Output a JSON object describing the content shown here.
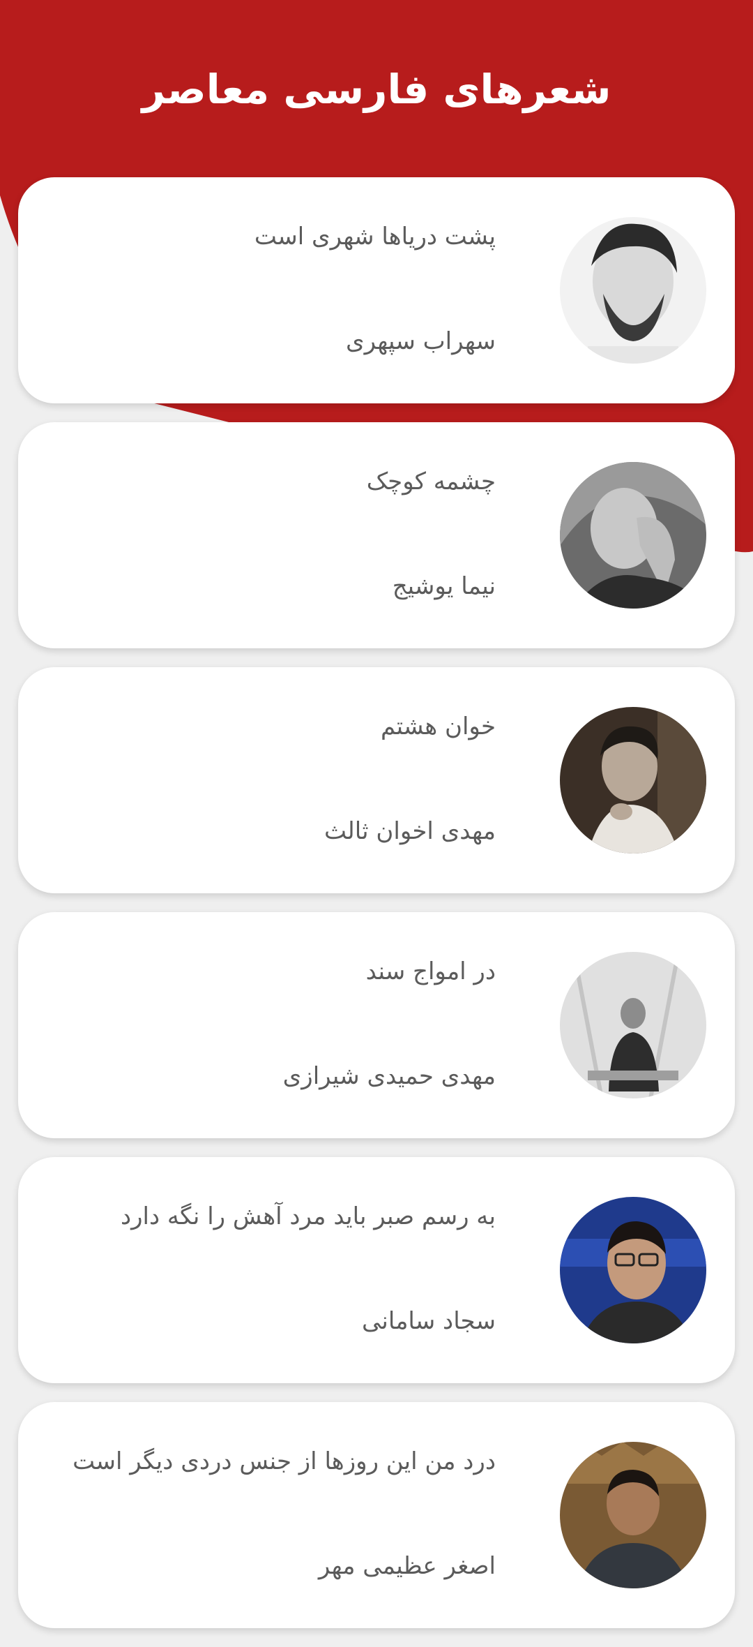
{
  "header": {
    "title": "شعرهای فارسی معاصر",
    "accent_color": "#b71c1c",
    "background_color": "#efefef"
  },
  "poems": [
    {
      "title": "پشت دریاها شهری است",
      "poet": "سهراب سپهری",
      "avatar_icon": "poet-portrait-icon"
    },
    {
      "title": "چشمه کوچک",
      "poet": "نیما یوشیج",
      "avatar_icon": "poet-portrait-icon"
    },
    {
      "title": "خوان هشتم",
      "poet": "مهدی اخوان ثالث",
      "avatar_icon": "poet-portrait-icon"
    },
    {
      "title": "در امواج سند",
      "poet": "مهدی حمیدی شیرازی",
      "avatar_icon": "poet-portrait-icon"
    },
    {
      "title": "به رسم صبر باید مرد آهش را نگه دارد",
      "poet": "سجاد سامانی",
      "avatar_icon": "poet-portrait-icon"
    },
    {
      "title": "درد من این روزها از جنس دردی دیگر است",
      "poet": "اصغر عظیمی مهر",
      "avatar_icon": "poet-portrait-icon"
    }
  ]
}
